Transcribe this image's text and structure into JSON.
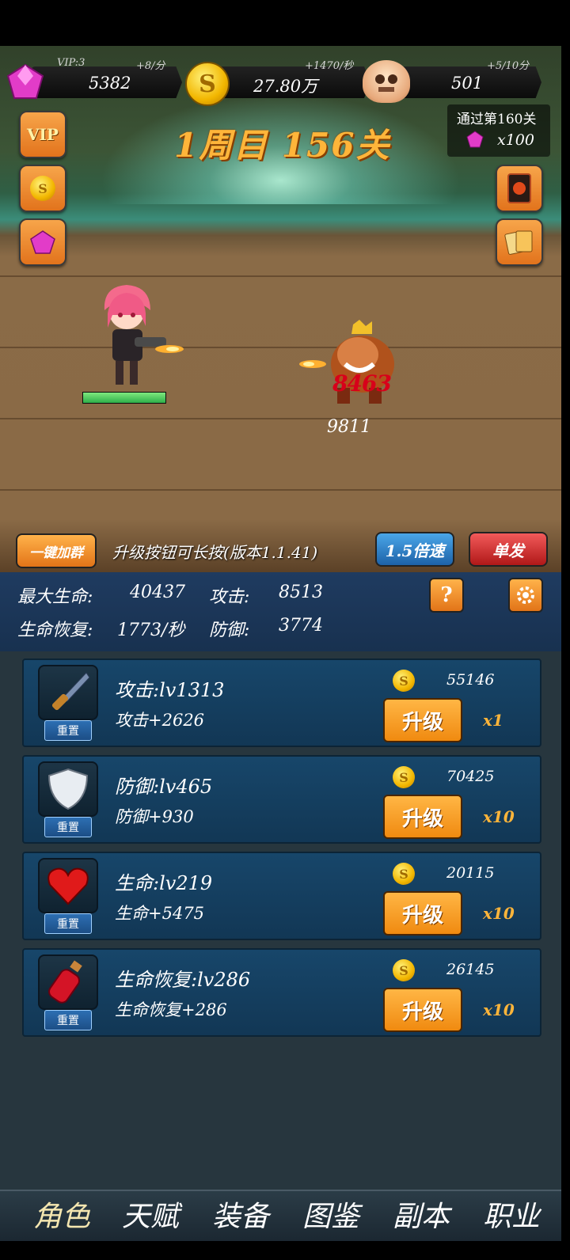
{
  "resources": {
    "gems": {
      "label": "VIP:3",
      "value": "5382",
      "rate": "+8/分",
      "icon": "gem-icon"
    },
    "gold": {
      "value": "27.80万",
      "rate": "+1470/秒",
      "icon": "coin-icon"
    },
    "skulls": {
      "value": "501",
      "rate": "+5/10分",
      "icon": "skull-icon"
    }
  },
  "stage": {
    "title": "1周目 156关"
  },
  "reward": {
    "label": "通过第160关",
    "amount": "x100"
  },
  "side_buttons": {
    "vip": "VIP"
  },
  "battle": {
    "damage": "8463",
    "enemy_hp": "9811"
  },
  "actions": {
    "join_group": "一键加群",
    "hint": "升级按钮可长按(版本1.1.41)",
    "speed": "1.5倍速",
    "single": "单发"
  },
  "stats": {
    "max_hp_label": "最大生命:",
    "max_hp": "40437",
    "attack_label": "攻击:",
    "attack": "8513",
    "regen_label": "生命恢复:",
    "regen": "1773/秒",
    "defense_label": "防御:",
    "defense": "3774"
  },
  "upgrades": [
    {
      "icon": "dagger-icon",
      "level": "攻击:lv1313",
      "bonus": "攻击+2626",
      "cost": "55146",
      "multiplier": "x1",
      "button": "升级",
      "reset": "重置"
    },
    {
      "icon": "shield-icon",
      "level": "防御:lv465",
      "bonus": "防御+930",
      "cost": "70425",
      "multiplier": "x10",
      "button": "升级",
      "reset": "重置"
    },
    {
      "icon": "heart-icon",
      "level": "生命:lv219",
      "bonus": "生命+5475",
      "cost": "20115",
      "multiplier": "x10",
      "button": "升级",
      "reset": "重置"
    },
    {
      "icon": "potion-icon",
      "level": "生命恢复:lv286",
      "bonus": "生命恢复+286",
      "cost": "26145",
      "multiplier": "x10",
      "button": "升级",
      "reset": "重置"
    }
  ],
  "tabs": [
    "角色",
    "天赋",
    "装备",
    "图鉴",
    "副本",
    "职业"
  ],
  "colors": {
    "accent": "#ffb53a",
    "upgrade": "#f08a10",
    "panel": "#17466a",
    "tab_active": "#f4e6b0"
  }
}
